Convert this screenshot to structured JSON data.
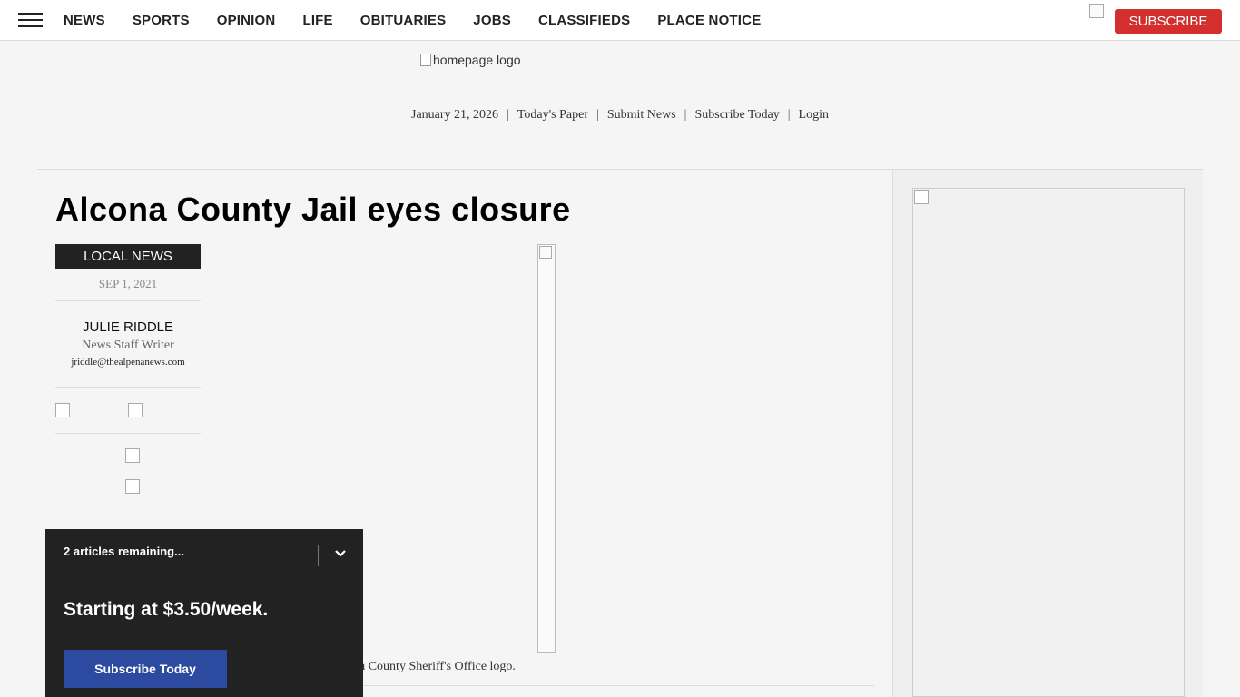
{
  "nav": {
    "items": [
      "NEWS",
      "SPORTS",
      "OPINION",
      "LIFE",
      "OBITUARIES",
      "JOBS",
      "CLASSIFIEDS",
      "PLACE NOTICE"
    ],
    "subscribe_label": "SUBSCRIBE"
  },
  "masthead": {
    "logo_alt": "homepage logo",
    "date": "January 21, 2026",
    "links": [
      "Today's Paper",
      "Submit News",
      "Subscribe Today",
      "Login"
    ]
  },
  "article": {
    "headline": "Alcona County Jail eyes closure",
    "section": "LOCAL NEWS",
    "date": "SEP 1, 2021",
    "author": "JULIE RIDDLE",
    "role": "News Staff Writer",
    "email": "jriddle@thealpenanews.com",
    "caption": "a County Sheriff's Office logo."
  },
  "paywall": {
    "remaining": "2 articles remaining...",
    "price": "Starting at $3.50/week.",
    "cta": "Subscribe Today"
  },
  "icons": {
    "menu": "hamburger-menu-icon",
    "collapse": "chevron-down-icon"
  },
  "colors": {
    "subscribe_red": "#d32f2f",
    "paywall_bg": "#222222",
    "cta_blue": "#2b4aa0"
  }
}
